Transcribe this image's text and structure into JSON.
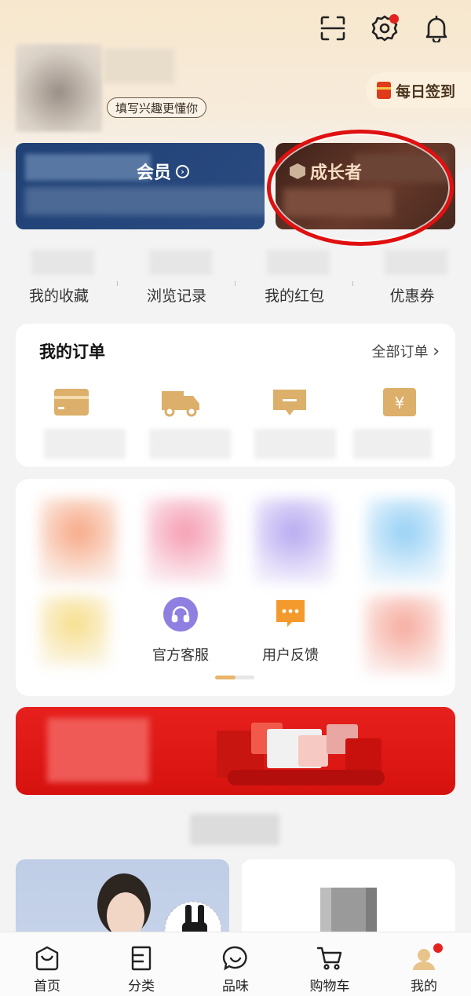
{
  "header": {
    "interest_tag": "填写兴趣更懂你",
    "checkin_label": "每日签到",
    "icons": [
      "scan-icon",
      "settings-icon",
      "bell-icon"
    ]
  },
  "cards": {
    "member_label": "会员",
    "grower_label": "成长者"
  },
  "quick_links": [
    "我的收藏",
    "浏览记录",
    "我的红包",
    "优惠券"
  ],
  "orders": {
    "title": "我的订单",
    "all_label": "全部订单",
    "icons": [
      "wallet-icon",
      "truck-icon",
      "comment-icon",
      "yen-icon"
    ]
  },
  "services": {
    "items": [
      {
        "label": "官方客服",
        "icon": "headset-icon"
      },
      {
        "label": "用户反馈",
        "icon": "feedback-icon"
      }
    ]
  },
  "tabbar": {
    "tabs": [
      "首页",
      "分类",
      "品味",
      "购物车",
      "我的"
    ]
  },
  "colors": {
    "accent_gold": "#e7b66c",
    "badge_red": "#e5231e",
    "member_blue": "#1f4176",
    "grower_brown": "#4a2a20",
    "banner_red": "#e01d1a"
  }
}
